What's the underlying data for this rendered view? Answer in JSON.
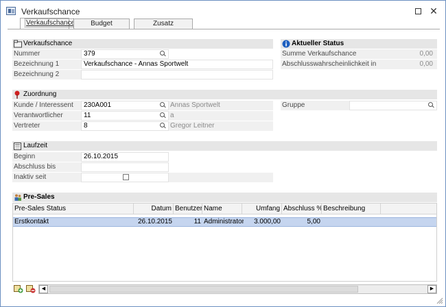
{
  "window": {
    "title": "Verkaufschance",
    "maximize_icon": "maximize-icon",
    "close_label": "✕"
  },
  "tabs": [
    {
      "label": "Verkaufschance",
      "active": true
    },
    {
      "label": "Budget",
      "active": false
    },
    {
      "label": "Zusatz",
      "active": false
    }
  ],
  "verkaufschance": {
    "header": "Verkaufschance",
    "icon": "folder-icon",
    "nummer_label": "Nummer",
    "nummer_value": "379",
    "bez1_label": "Bezeichnung 1",
    "bez1_value": "Verkaufschance - Annas Sportwelt",
    "bez2_label": "Bezeichnung 2",
    "bez2_value": ""
  },
  "status": {
    "header": "Aktueller Status",
    "icon": "info-icon",
    "summe_label": "Summe Verkaufschance",
    "summe_value": "0,00",
    "wahrsch_label": "Abschlusswahrscheinlichkeit in %",
    "wahrsch_value": "0,00"
  },
  "zuordnung": {
    "header": "Zuordnung",
    "icon": "pin-icon",
    "kunde_label": "Kunde / Interessent",
    "kunde_value": "230A001",
    "kunde_name": "Annas Sportwelt",
    "verantw_label": "Verantwortlicher",
    "verantw_value": "11",
    "verantw_name": "a",
    "vertreter_label": "Vertreter",
    "vertreter_value": "8",
    "vertreter_name": "Gregor Leitner",
    "gruppe_label": "Gruppe",
    "gruppe_value": ""
  },
  "laufzeit": {
    "header": "Laufzeit",
    "icon": "calendar-icon",
    "beginn_label": "Beginn",
    "beginn_value": "26.10.2015",
    "abschluss_label": "Abschluss bis",
    "abschluss_value": "",
    "inaktiv_label": "Inaktiv seit",
    "inaktiv_checked": false
  },
  "presales": {
    "header": "Pre-Sales",
    "icon": "people-icon",
    "columns": [
      "Pre-Sales Status",
      "Datum",
      "Benutzer",
      "Name",
      "Umfang",
      "Abschluss %",
      "Beschreibung"
    ],
    "rows": [
      {
        "status": "Erstkontakt",
        "datum": "26.10.2015",
        "benutzer": "11",
        "name": "Administrator",
        "umfang": "3.000,00",
        "abschluss": "5,00",
        "beschreibung": ""
      }
    ]
  },
  "toolbar": {
    "add_icon": "add-row-icon",
    "delete_icon": "delete-row-icon",
    "scroll_left": "◀",
    "scroll_right": "▶"
  }
}
